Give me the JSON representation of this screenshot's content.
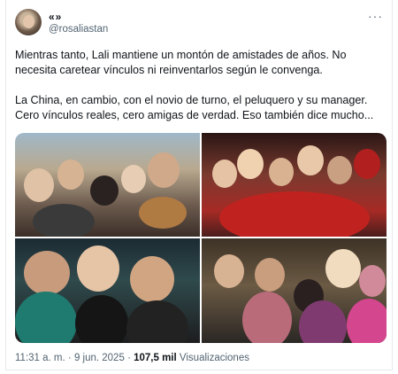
{
  "tweet": {
    "display_name": "«»",
    "handle": "@rosaliastan",
    "more_icon": "···",
    "text_line_1": "Mientras tanto, Lali mantiene un montón de amistades de años. No",
    "text_line_2": "necesita caretear vínculos ni reinventarlos según le convenga.",
    "text_line_3": "La China, en cambio, con el novio de turno, el peluquero y su manager.",
    "text_line_4": "Cero vínculos reales, cero amigas de verdad. Eso también dice mucho...",
    "time": "11:31 a. m.",
    "separator": "·",
    "date": "9 jun. 2025",
    "views_count": "107,5 mil",
    "views_label": "Visualizaciones"
  },
  "colors": {
    "text_primary": "#0f1419",
    "text_secondary": "#536471",
    "border": "#e6e9ec"
  }
}
